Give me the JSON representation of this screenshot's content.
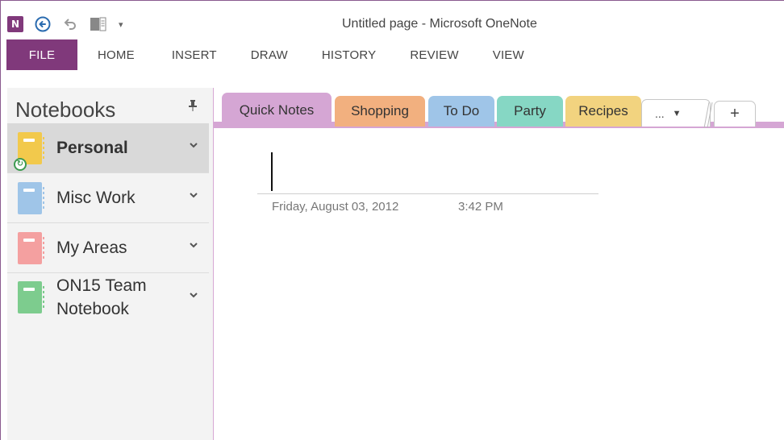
{
  "window": {
    "title": "Untitled page - Microsoft OneNote"
  },
  "quick_access": [
    {
      "name": "onenote-logo-icon",
      "glyph": "N"
    },
    {
      "name": "back-icon",
      "glyph": "←"
    },
    {
      "name": "undo-icon",
      "glyph": "↶"
    },
    {
      "name": "dock-to-desktop-icon",
      "glyph": "▥"
    },
    {
      "name": "customize-qat-icon",
      "glyph": "▾"
    }
  ],
  "ribbon": {
    "tabs": [
      "FILE",
      "HOME",
      "INSERT",
      "DRAW",
      "HISTORY",
      "REVIEW",
      "VIEW"
    ]
  },
  "notebooks": {
    "header": "Notebooks",
    "pin_glyph": "📌",
    "items": [
      {
        "label": "Personal",
        "color": "#f2c94c",
        "selected": true
      },
      {
        "label": "Misc Work",
        "color": "#9fc5e8",
        "selected": false
      },
      {
        "label": "My Areas",
        "color": "#f4a0a0",
        "selected": false
      },
      {
        "label": "ON15 Team",
        "label2": "Notebook",
        "color": "#7dcc8e",
        "selected": false
      }
    ],
    "chevron": "⌄"
  },
  "sections": {
    "tabs": [
      {
        "label": "Quick Notes",
        "color": "#d5a6d4"
      },
      {
        "label": "Shopping",
        "color": "#f2b07f"
      },
      {
        "label": "To Do",
        "color": "#9fc5e8"
      },
      {
        "label": "Party",
        "color": "#86d7c4"
      },
      {
        "label": "Recipes",
        "color": "#f2d37f"
      }
    ],
    "more_label": "...",
    "more_arrow": "▼",
    "add_label": "+"
  },
  "page": {
    "date": "Friday, August 03, 2012",
    "time": "3:42 PM"
  }
}
